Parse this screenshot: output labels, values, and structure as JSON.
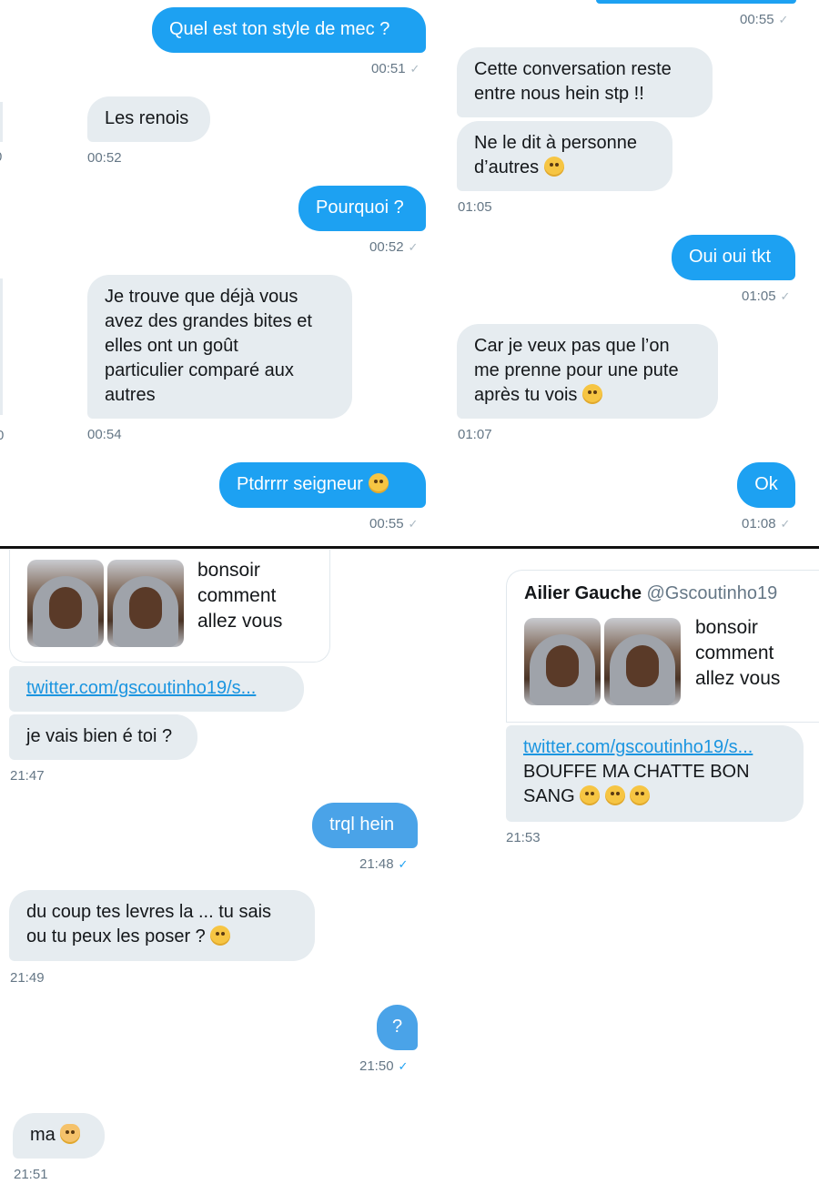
{
  "top_left": {
    "messages": [
      {
        "text": "Quel est ton style de mec ?",
        "time": "00:51"
      },
      {
        "text": "Les renois",
        "time": "00:52"
      },
      {
        "text": "Pourquoi ?",
        "time": "00:52"
      },
      {
        "text": "Je trouve que déjà vous\navez des grandes bites et\nelles ont un goût\nparticulier comparé aux\nautres",
        "time": "00:54"
      },
      {
        "text": "Ptdrrrr seigneur",
        "time": "00:55"
      }
    ],
    "edge_fragment_1": "0",
    "edge_fragment_2": "0"
  },
  "top_right": {
    "top_time": "00:55",
    "messages": [
      {
        "text": "Cette conversation reste\nentre nous hein stp !!"
      },
      {
        "text": "Ne le dit à personne\nd’autres",
        "time": "01:05"
      },
      {
        "text": "Oui oui tkt",
        "time": "01:05"
      },
      {
        "text": "Car je veux pas que l’on\nme prenne pour une pute\naprès tu vois",
        "time": "01:07"
      },
      {
        "text": "Ok",
        "time": "01:08"
      }
    ]
  },
  "bottom_left": {
    "card_text": "bonsoir\ncomment\nallez vous",
    "link": "twitter.com/gscoutinho19/s...",
    "messages": [
      {
        "text": "je vais bien é toi ?",
        "time": "21:47"
      },
      {
        "text": "trql hein",
        "time": "21:48"
      },
      {
        "text": "du coup tes levres la ... tu sais\nou tu peux les poser ?",
        "time": "21:49"
      },
      {
        "text": "?",
        "time": "21:50"
      },
      {
        "text": "ma",
        "time": "21:51"
      }
    ]
  },
  "bottom_right": {
    "author_name": "Ailier Gauche",
    "author_handle": "@Gscoutinho19",
    "card_text": "bonsoir\ncomment\nallez vous",
    "link": "twitter.com/gscoutinho19/s...",
    "message": "BOUFFE MA CHATTE BON\nSANG",
    "time": "21:53"
  },
  "icons": {
    "read_receipt": "✓",
    "emoji_crying": "crying-emoji-icon",
    "emoji_yum": "yum-emoji-icon",
    "emoji_sweat": "sweat-smile-emoji-icon",
    "emoji_eyeroll": "eye-roll-emoji-icon",
    "emoji_cat": "cat-emoji-icon"
  },
  "colors": {
    "outgoing": "#1da1f2",
    "incoming": "#e6ecf0",
    "link": "#1b95e0",
    "timestamp": "#657786"
  }
}
